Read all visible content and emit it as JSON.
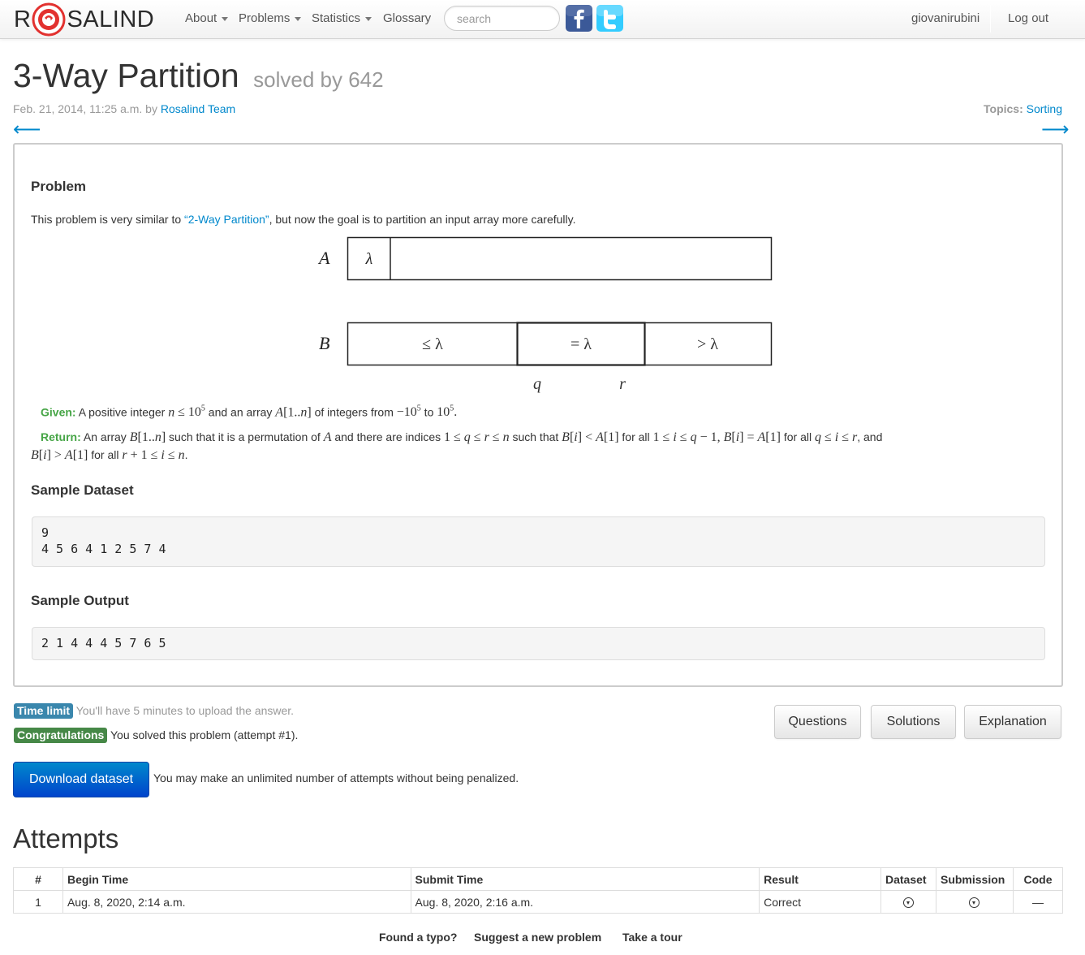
{
  "navbar": {
    "brand_left": "R",
    "brand_right": "SALIND",
    "menus": [
      "About",
      "Problems",
      "Statistics",
      "Glossary"
    ],
    "search_placeholder": "search",
    "username": "giovanirubini",
    "logout": "Log out"
  },
  "header": {
    "title": "3-Way Partition",
    "solved_by": "solved by 642",
    "date": "Feb. 21, 2014, 11:25 a.m. by ",
    "author": "Rosalind Team",
    "topics_label": "Topics:",
    "topic": "Sorting",
    "prev_arrow": "⟵",
    "next_arrow": "⟶"
  },
  "problem": {
    "heading": "Problem",
    "intro_before": "This problem is very similar to ",
    "intro_link": "“2-Way Partition”",
    "intro_after": ", but now the goal is to partition an input array more carefully.",
    "diagram": {
      "label_a": "A",
      "label_b": "B",
      "lambda": "λ",
      "le_lambda": "≤ λ",
      "eq_lambda": "= λ",
      "gt_lambda": "> λ",
      "q": "q",
      "r": "r"
    },
    "given_label": "Given:",
    "return_label": "Return:",
    "sample_dataset_heading": "Sample Dataset",
    "sample_dataset_lines": "9\n4 5 6 4 1 2 5 7 4",
    "sample_output_heading": "Sample Output",
    "sample_output": "2 1 4 4 4 5 7 6 5"
  },
  "status": {
    "time_limit_label": "Time limit",
    "time_limit_text": "You'll have 5 minutes to upload the answer.",
    "congrats_label": "Congratulations",
    "congrats_text": "You solved this problem (attempt #1).",
    "download_label": "Download dataset",
    "unlimited_text": "You may make an unlimited number of attempts without being penalized.",
    "buttons": [
      "Questions",
      "Solutions",
      "Explanation"
    ]
  },
  "attempts": {
    "heading": "Attempts",
    "columns": [
      "#",
      "Begin Time",
      "Submit Time",
      "Result",
      "Dataset",
      "Submission",
      "Code"
    ],
    "rows": [
      {
        "num": "1",
        "begin": "Aug. 8, 2020, 2:14 a.m.",
        "submit": "Aug. 8, 2020, 2:16 a.m.",
        "result": "Correct",
        "code": "—"
      }
    ]
  },
  "footer": {
    "links": [
      "Found a typo?",
      "Suggest a new problem",
      "Take a tour"
    ]
  },
  "colors": {
    "link": "#0088cc",
    "given_return": "#46a546",
    "label_info": "#3a87ad",
    "label_success": "#468847",
    "primary_button": "#0055cc",
    "facebook": "#3b5998",
    "twitter": "#33ccff"
  }
}
